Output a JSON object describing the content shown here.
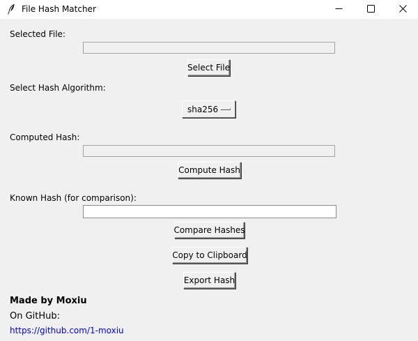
{
  "window": {
    "title": "File Hash Matcher",
    "icon": "feather-icon",
    "controls": [
      "minimize-icon",
      "maximize-icon",
      "close-icon"
    ]
  },
  "selected_file": {
    "label": "Selected File:",
    "value": "",
    "button_label": "Select File"
  },
  "algorithm": {
    "label": "Select Hash Algorithm:",
    "selected": "sha256"
  },
  "computed": {
    "label": "Computed Hash:",
    "value": "",
    "button_label": "Compute Hash"
  },
  "known": {
    "label": "Known Hash (for comparison):",
    "value": "",
    "compare_label": "Compare Hashes",
    "copy_label": "Copy to Clipboard",
    "export_label": "Export Hash"
  },
  "footer": {
    "made_by": "Made by Moxiu",
    "on_github": "On GitHub:",
    "link": "https://github.com/1-moxiu"
  },
  "colors": {
    "background": "#f0f0f0",
    "titlebar": "#ffffff",
    "link": "#0000ee"
  }
}
